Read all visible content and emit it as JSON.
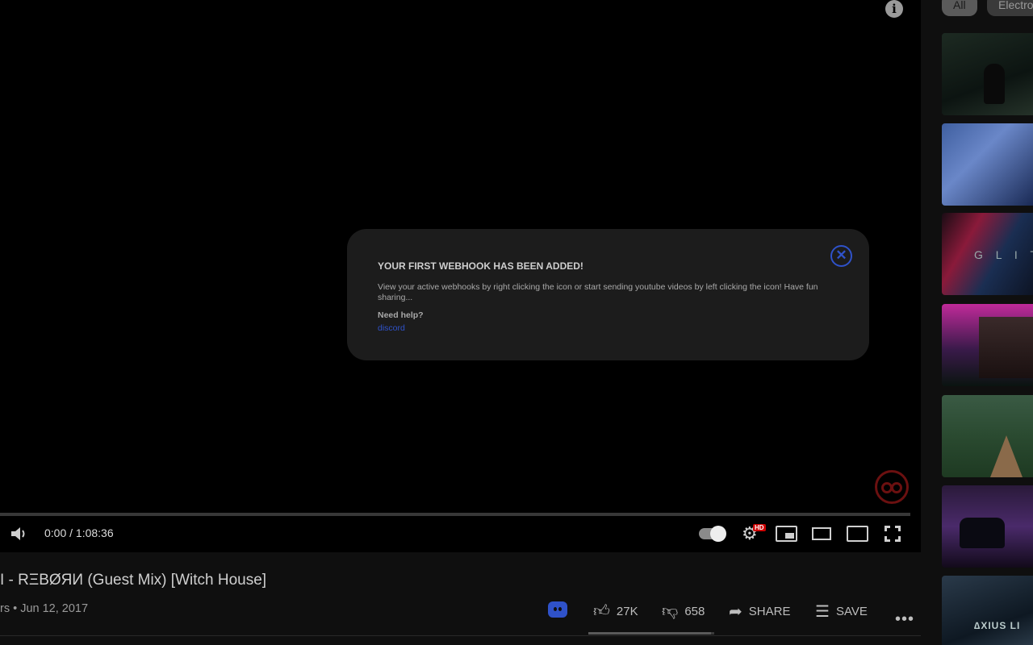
{
  "player": {
    "time": "0:00 / 1:08:36",
    "progress_fraction": 0.0,
    "quality_badge": "HD",
    "info_glyph": "i",
    "icons": [
      "info-icon",
      "volume-icon",
      "autoplay-toggle",
      "settings-icon",
      "miniplayer-icon",
      "theater-mode-icon",
      "cast-icon",
      "fullscreen-icon",
      "extension-badge-icon"
    ]
  },
  "modal": {
    "title": "YOUR FIRST WEBHOOK HAS BEEN ADDED!",
    "body": "View your active webhooks by right clicking the icon or start sending youtube videos by left clicking the icon! Have fun sharing...",
    "help_label": "Need help?",
    "help_link": "discord",
    "close_glyph": "✕",
    "accent": "#2f52c9"
  },
  "video": {
    "title": "I - RΞBØЯИ (Guest Mix) [Witch House]",
    "meta": "rs • Jun 12, 2017"
  },
  "actions": {
    "likes": "27K",
    "dislikes": "658",
    "share": "SHARE",
    "save": "SAVE",
    "more_glyph": "•••",
    "like_ratio": 0.976
  },
  "sidebar": {
    "chips": [
      "All",
      "Electro"
    ],
    "thumb_text": [
      "G L I T",
      "∆XIUS LI"
    ]
  },
  "colors": {
    "background": "#0f0f0f",
    "player": "#000000",
    "modal": "#1c1c1c",
    "accent": "#2f52c9",
    "extension": "#6b1010"
  }
}
